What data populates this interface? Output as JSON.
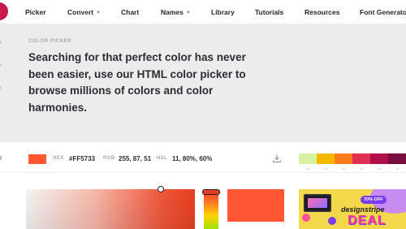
{
  "nav": {
    "items": [
      {
        "label": "Picker",
        "dropdown": false
      },
      {
        "label": "Convert",
        "dropdown": true
      },
      {
        "label": "Chart",
        "dropdown": false
      },
      {
        "label": "Names",
        "dropdown": true
      },
      {
        "label": "Library",
        "dropdown": false
      },
      {
        "label": "Tutorials",
        "dropdown": false
      },
      {
        "label": "Resources",
        "dropdown": false
      },
      {
        "label": "Font Generator",
        "dropdown": false
      }
    ],
    "brand_color": "#c9184a"
  },
  "hero": {
    "kicker": "COLOR PICKER",
    "title": "Searching for that perfect color has never been easier, use our HTML color picker to browse millions of colors and color harmonies."
  },
  "toolbar": {
    "swatch_color": "#FF5733",
    "hex_label": "HEX",
    "hex_value": "#FF5733",
    "rgb_label": "RGB",
    "rgb_value": "255, 87, 51",
    "hsl_label": "HSL",
    "hsl_value": "11, 80%, 60%",
    "download_icon": "download-icon"
  },
  "harmony": {
    "colors": [
      "#d7f2a0",
      "#f5b800",
      "#ff7a1a",
      "#e02f52",
      "#b01048",
      "#7a0d3f"
    ],
    "labels": [
      "1a",
      "1b",
      "1c",
      "1d",
      "1e",
      "1f"
    ]
  },
  "picker": {
    "selected_color": "#FF5733"
  },
  "ad": {
    "badge": "70% OFF",
    "brand": "designstripe",
    "headline": "DEAL"
  }
}
